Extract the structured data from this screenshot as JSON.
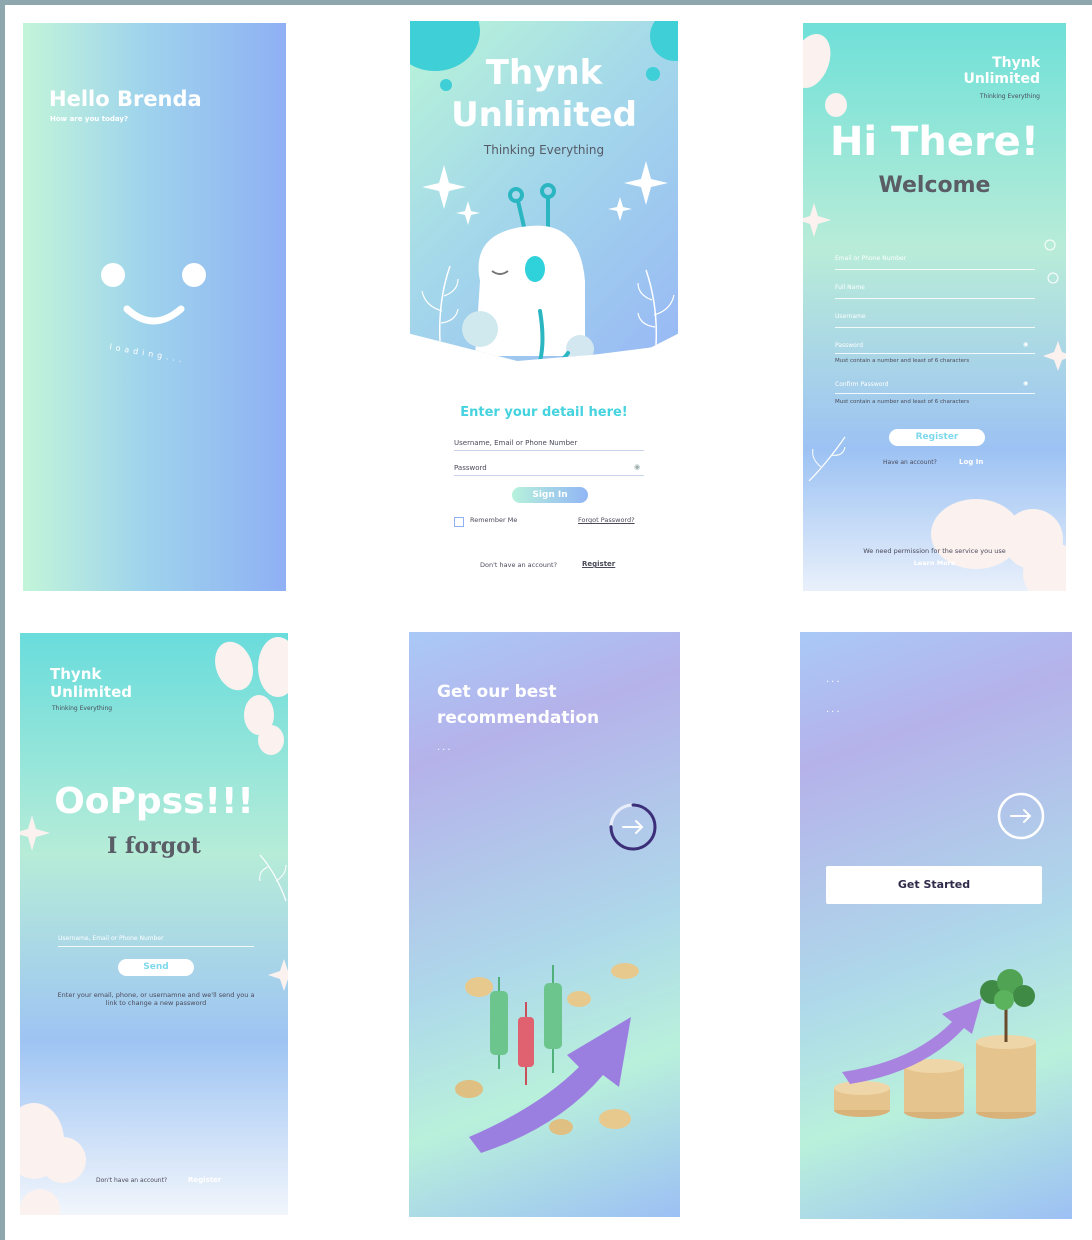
{
  "colors": {
    "accent_cyan": "#44d3df",
    "gradient_mint": "#c3f5d9",
    "gradient_blue": "#8fb0f4",
    "button_teal": "#7ed9ee",
    "dark_text": "#4a4a5a",
    "cream_blob": "#fbf1ef"
  },
  "loading": {
    "greeting": "Hello Brenda",
    "subtitle": "How are you today?",
    "loading_text": "loading..."
  },
  "signin": {
    "brand_line1": "Thynk",
    "brand_line2": "Unlimited",
    "tagline": "Thinking Everything",
    "heading": "Enter your detail here!",
    "username_placeholder": "Username, Email or Phone Number",
    "password_placeholder": "Password",
    "signin_button": "Sign In",
    "remember_me": "Remember Me",
    "forgot_password": "Forgot Password?",
    "no_account_text": "Don't have an account?",
    "register_link": "Register"
  },
  "register": {
    "logo_line1": "Thynk",
    "logo_line2": "Unlimited",
    "logo_tagline": "Thinking Everything",
    "heading": "Hi There!",
    "subheading": "Welcome",
    "fields": [
      {
        "label": "Email or Phone Number"
      },
      {
        "label": "Full Name"
      },
      {
        "label": "Username"
      },
      {
        "label": "Password",
        "hint": "Must contain a number and least of 6 characters"
      },
      {
        "label": "Confirm Password",
        "hint": "Must contain a number and least of 6 characters"
      }
    ],
    "register_button": "Register",
    "have_account_text": "Have an account?",
    "login_link": "Log In",
    "permission_text": "We need permission for the service you use",
    "learn_more": "Learn More"
  },
  "forgot": {
    "logo_line1": "Thynk",
    "logo_line2": "Unlimited",
    "logo_tagline": "Thinking Everything",
    "heading": "OoPpss!!!",
    "subheading": "I forgot",
    "input_placeholder": "Username, Email or Phone Number",
    "send_button": "Send",
    "instructions": "Enter your email, phone, or usernamne and we'll send you a link to change a new password",
    "no_account_text": "Don't have an account?",
    "register_link": "Register"
  },
  "onboard1": {
    "headline_line1": "Get our best",
    "headline_line2": "recommendation",
    "dots": "...",
    "progress": 0.75
  },
  "onboard2": {
    "dots_top": "...",
    "dots_bottom": "...",
    "get_started_button": "Get Started"
  }
}
